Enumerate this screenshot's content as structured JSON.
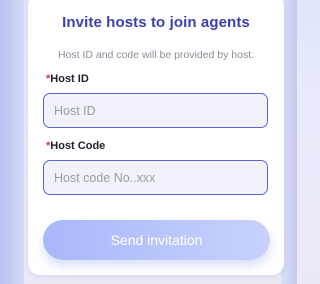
{
  "dialog": {
    "title": "Invite hosts to join agents",
    "subtitle": "Host ID and code will be provided by host."
  },
  "host_id": {
    "required_mark": "*",
    "label": "Host ID",
    "placeholder": "Host ID",
    "value": ""
  },
  "host_code": {
    "required_mark": "*",
    "label": "Host Code",
    "placeholder": "Host code No..xxx",
    "value": ""
  },
  "send_button": {
    "label": "Send invitation"
  },
  "colors": {
    "accent": "#3b3fb0",
    "required": "#e0304c",
    "input_border": "#5a63d8",
    "button_gradient_start": "#a9b7fb",
    "button_gradient_end": "#c9d1fb"
  }
}
